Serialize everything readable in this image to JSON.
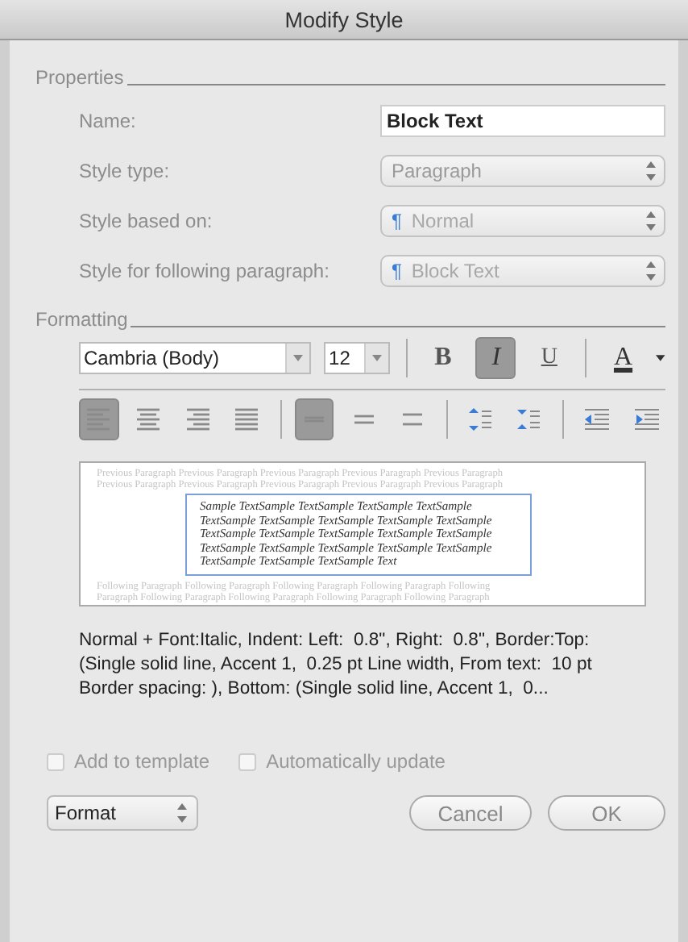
{
  "window": {
    "title": "Modify Style"
  },
  "properties": {
    "legend": "Properties",
    "name": {
      "label": "Name:",
      "value": "Block Text"
    },
    "style_type": {
      "label": "Style type:",
      "value": "Paragraph",
      "disabled": true
    },
    "style_based_on": {
      "label": "Style based on:",
      "marker": "¶",
      "value": "Normal",
      "disabled": true
    },
    "following_style": {
      "label": "Style for following paragraph:",
      "marker": "¶",
      "value": "Block Text",
      "disabled": true
    }
  },
  "formatting": {
    "legend": "Formatting",
    "font": {
      "value": "Cambria (Body)"
    },
    "size": {
      "value": "12"
    },
    "text_buttons": [
      {
        "kind": "bold",
        "label": "B",
        "selected": false
      },
      {
        "kind": "italic",
        "label": "I",
        "selected": true
      },
      {
        "kind": "underline",
        "label": "U",
        "selected": false
      },
      {
        "kind": "color",
        "label": "A",
        "selected": false
      }
    ],
    "paragraph_buttons": [
      {
        "kind": "align-left",
        "selected": true
      },
      {
        "kind": "align-center",
        "selected": false
      },
      {
        "kind": "align-right",
        "selected": false
      },
      {
        "kind": "justify",
        "selected": false
      },
      {
        "kind": "single",
        "selected": true
      },
      {
        "kind": "one-half",
        "selected": false
      },
      {
        "kind": "double",
        "selected": false
      },
      {
        "kind": "space-more",
        "selected": false
      },
      {
        "kind": "space-less",
        "selected": false
      },
      {
        "kind": "outdent",
        "selected": false
      },
      {
        "kind": "indent",
        "selected": false
      }
    ]
  },
  "preview": {
    "previous": [
      "Previous Paragraph Previous Paragraph Previous Paragraph Previous Paragraph Previous Paragraph",
      "Previous Paragraph Previous Paragraph Previous Paragraph Previous Paragraph Previous Paragraph"
    ],
    "sample": [
      "Sample TextSample TextSample TextSample TextSample",
      "TextSample TextSample TextSample TextSample TextSample",
      "TextSample TextSample TextSample TextSample TextSample",
      "TextSample TextSample TextSample TextSample TextSample",
      "TextSample TextSample TextSample Text"
    ],
    "following": [
      "Following Paragraph Following Paragraph Following Paragraph Following Paragraph Following",
      "Paragraph Following Paragraph Following Paragraph Following Paragraph Following Paragraph"
    ]
  },
  "description": [
    "Normal + Font:Italic, Indent: Left:  0.8\", Right:  0.8\", Border:Top:",
    "(Single solid line, Accent 1,  0.25 pt Line width, From text:  10 pt",
    "Border spacing: ), Bottom: (Single solid line, Accent 1,  0..."
  ],
  "options": [
    {
      "label": "Add to template",
      "checked": false,
      "disabled": true
    },
    {
      "label": "Automatically update",
      "checked": false,
      "disabled": true
    }
  ],
  "format_menu": {
    "value": "Format"
  },
  "buttons": [
    {
      "label": "Cancel",
      "kind": "cancel"
    },
    {
      "label": "OK",
      "kind": "ok"
    }
  ]
}
